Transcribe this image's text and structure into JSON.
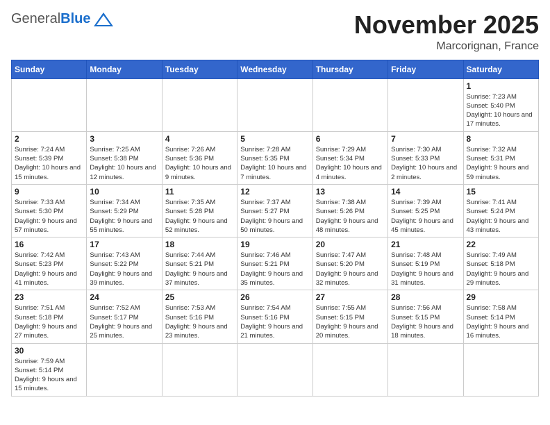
{
  "logo": {
    "general": "General",
    "blue": "Blue"
  },
  "title": "November 2025",
  "location": "Marcorignan, France",
  "days_of_week": [
    "Sunday",
    "Monday",
    "Tuesday",
    "Wednesday",
    "Thursday",
    "Friday",
    "Saturday"
  ],
  "weeks": [
    [
      {
        "day": "",
        "info": ""
      },
      {
        "day": "",
        "info": ""
      },
      {
        "day": "",
        "info": ""
      },
      {
        "day": "",
        "info": ""
      },
      {
        "day": "",
        "info": ""
      },
      {
        "day": "",
        "info": ""
      },
      {
        "day": "1",
        "info": "Sunrise: 7:23 AM\nSunset: 5:40 PM\nDaylight: 10 hours\nand 17 minutes."
      }
    ],
    [
      {
        "day": "2",
        "info": "Sunrise: 7:24 AM\nSunset: 5:39 PM\nDaylight: 10 hours\nand 15 minutes."
      },
      {
        "day": "3",
        "info": "Sunrise: 7:25 AM\nSunset: 5:38 PM\nDaylight: 10 hours\nand 12 minutes."
      },
      {
        "day": "4",
        "info": "Sunrise: 7:26 AM\nSunset: 5:36 PM\nDaylight: 10 hours\nand 9 minutes."
      },
      {
        "day": "5",
        "info": "Sunrise: 7:28 AM\nSunset: 5:35 PM\nDaylight: 10 hours\nand 7 minutes."
      },
      {
        "day": "6",
        "info": "Sunrise: 7:29 AM\nSunset: 5:34 PM\nDaylight: 10 hours\nand 4 minutes."
      },
      {
        "day": "7",
        "info": "Sunrise: 7:30 AM\nSunset: 5:33 PM\nDaylight: 10 hours\nand 2 minutes."
      },
      {
        "day": "8",
        "info": "Sunrise: 7:32 AM\nSunset: 5:31 PM\nDaylight: 9 hours\nand 59 minutes."
      }
    ],
    [
      {
        "day": "9",
        "info": "Sunrise: 7:33 AM\nSunset: 5:30 PM\nDaylight: 9 hours\nand 57 minutes."
      },
      {
        "day": "10",
        "info": "Sunrise: 7:34 AM\nSunset: 5:29 PM\nDaylight: 9 hours\nand 55 minutes."
      },
      {
        "day": "11",
        "info": "Sunrise: 7:35 AM\nSunset: 5:28 PM\nDaylight: 9 hours\nand 52 minutes."
      },
      {
        "day": "12",
        "info": "Sunrise: 7:37 AM\nSunset: 5:27 PM\nDaylight: 9 hours\nand 50 minutes."
      },
      {
        "day": "13",
        "info": "Sunrise: 7:38 AM\nSunset: 5:26 PM\nDaylight: 9 hours\nand 48 minutes."
      },
      {
        "day": "14",
        "info": "Sunrise: 7:39 AM\nSunset: 5:25 PM\nDaylight: 9 hours\nand 45 minutes."
      },
      {
        "day": "15",
        "info": "Sunrise: 7:41 AM\nSunset: 5:24 PM\nDaylight: 9 hours\nand 43 minutes."
      }
    ],
    [
      {
        "day": "16",
        "info": "Sunrise: 7:42 AM\nSunset: 5:23 PM\nDaylight: 9 hours\nand 41 minutes."
      },
      {
        "day": "17",
        "info": "Sunrise: 7:43 AM\nSunset: 5:22 PM\nDaylight: 9 hours\nand 39 minutes."
      },
      {
        "day": "18",
        "info": "Sunrise: 7:44 AM\nSunset: 5:21 PM\nDaylight: 9 hours\nand 37 minutes."
      },
      {
        "day": "19",
        "info": "Sunrise: 7:46 AM\nSunset: 5:21 PM\nDaylight: 9 hours\nand 35 minutes."
      },
      {
        "day": "20",
        "info": "Sunrise: 7:47 AM\nSunset: 5:20 PM\nDaylight: 9 hours\nand 32 minutes."
      },
      {
        "day": "21",
        "info": "Sunrise: 7:48 AM\nSunset: 5:19 PM\nDaylight: 9 hours\nand 31 minutes."
      },
      {
        "day": "22",
        "info": "Sunrise: 7:49 AM\nSunset: 5:18 PM\nDaylight: 9 hours\nand 29 minutes."
      }
    ],
    [
      {
        "day": "23",
        "info": "Sunrise: 7:51 AM\nSunset: 5:18 PM\nDaylight: 9 hours\nand 27 minutes."
      },
      {
        "day": "24",
        "info": "Sunrise: 7:52 AM\nSunset: 5:17 PM\nDaylight: 9 hours\nand 25 minutes."
      },
      {
        "day": "25",
        "info": "Sunrise: 7:53 AM\nSunset: 5:16 PM\nDaylight: 9 hours\nand 23 minutes."
      },
      {
        "day": "26",
        "info": "Sunrise: 7:54 AM\nSunset: 5:16 PM\nDaylight: 9 hours\nand 21 minutes."
      },
      {
        "day": "27",
        "info": "Sunrise: 7:55 AM\nSunset: 5:15 PM\nDaylight: 9 hours\nand 20 minutes."
      },
      {
        "day": "28",
        "info": "Sunrise: 7:56 AM\nSunset: 5:15 PM\nDaylight: 9 hours\nand 18 minutes."
      },
      {
        "day": "29",
        "info": "Sunrise: 7:58 AM\nSunset: 5:14 PM\nDaylight: 9 hours\nand 16 minutes."
      }
    ],
    [
      {
        "day": "30",
        "info": "Sunrise: 7:59 AM\nSunset: 5:14 PM\nDaylight: 9 hours\nand 15 minutes."
      },
      {
        "day": "",
        "info": ""
      },
      {
        "day": "",
        "info": ""
      },
      {
        "day": "",
        "info": ""
      },
      {
        "day": "",
        "info": ""
      },
      {
        "day": "",
        "info": ""
      },
      {
        "day": "",
        "info": ""
      }
    ]
  ]
}
